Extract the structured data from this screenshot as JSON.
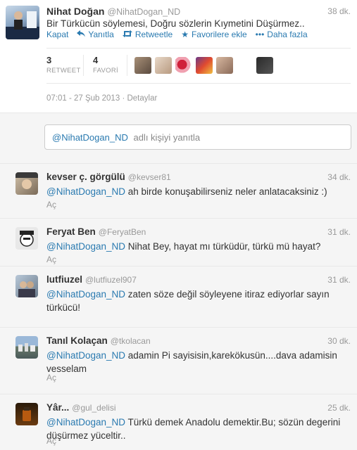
{
  "main_tweet": {
    "name": "Nihat Doğan",
    "handle": "@NihatDogan_ND",
    "time": "38 dk.",
    "text": "Bir Türkücün söylemesi, Doğru sözlerin Kıymetini Düşürmez..",
    "actions": {
      "collapse": "Kapat",
      "reply": "Yanıtla",
      "retweet": "Retweetle",
      "favorite": "Favorilere ekle",
      "more": "Daha fazla"
    },
    "retweet_count": "3",
    "retweet_label": "RETWEET",
    "favorite_count": "4",
    "favorite_label": "FAVORİ",
    "timestamp": "07:01 - 27 Şub 2013",
    "details_link": "Detaylar"
  },
  "reply_box": {
    "mention": "@NihatDogan_ND",
    "placeholder": "adlı kişiyi yanıtla"
  },
  "replies": [
    {
      "name": "kevser ç. görgülü",
      "handle": "@kevser81",
      "time": "34 dk.",
      "mention": "@NihatDogan_ND",
      "text": "ah birde konuşabilirseniz neler anlatacaksiniz :)",
      "open": "Aç"
    },
    {
      "name": "Feryat Ben",
      "handle": "@FeryatBen",
      "time": "31 dk.",
      "mention": "@NihatDogan_ND",
      "text": "Nihat Bey, hayat mı türküdür, türkü mü hayat?",
      "open": "Aç"
    },
    {
      "name": "lutfiuzel",
      "handle": "@lutfiuzel907",
      "time": "31 dk.",
      "mention": "@NihatDogan_ND",
      "text": "zaten söze değil söyleyene itiraz ediyorlar sayın türkücü!",
      "open": "Aç"
    },
    {
      "name": "Tanıl Kolaçan",
      "handle": "@tkolacan",
      "time": "30 dk.",
      "mention": "@NihatDogan_ND",
      "text": "adamin Pi sayisisin,karekökusün....dava adamisin vesselam",
      "open": "Aç"
    },
    {
      "name": "Yâr...",
      "handle": "@gul_delisi",
      "time": "25 dk.",
      "mention": "@NihatDogan_ND",
      "text": "Türkü demek Anadolu demektir.Bu; sözün degerini düşürmez yüceltir..",
      "open": "Aç"
    }
  ],
  "colors": {
    "link": "#2a7ab0",
    "muted": "#999999",
    "text": "#333333",
    "background": "#f5f5f5"
  }
}
